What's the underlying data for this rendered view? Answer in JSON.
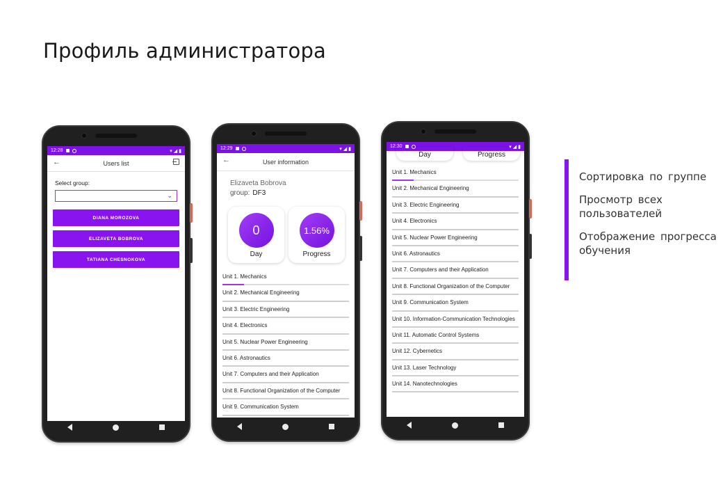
{
  "slide": {
    "title": "Профиль администратора",
    "accent_color": "#8a14f0",
    "bullets": [
      "Сортировка по группе",
      "Просмотр всех пользователей",
      "Отображение прогресса обучения"
    ]
  },
  "phones": [
    {
      "time": "12:28",
      "header": "Users list",
      "select_label": "Select group:",
      "select_value": "",
      "users": [
        "DIANA MOROZOVA",
        "ELIZAVETA BOBROVA",
        "TATIANA CHESNOKOVA"
      ]
    },
    {
      "time": "12:29",
      "header": "User information",
      "user_name": "Elizaveta Bobrova",
      "group_label": "group:",
      "group_value": "DF3",
      "day_value": "0",
      "day_label": "Day",
      "progress_value": "1.56%",
      "progress_label": "Progress",
      "units": [
        "Unit 1. Mechanics",
        "Unit 2. Mechanical Engineering",
        "Unit 3. Electric Engineering",
        "Unit 4. Electronics",
        "Unit 5. Nuclear Power Engineering",
        "Unit 6. Astronautics",
        "Unit 7. Computers and their Application",
        "Unit 8. Functional Organization of the Computer",
        "Unit 9. Communication System"
      ]
    },
    {
      "time": "12:30",
      "day_label": "Day",
      "progress_label": "Progress",
      "units": [
        "Unit 1. Mechanics",
        "Unit 2. Mechanical Engineering",
        "Unit 3. Electric Engineering",
        "Unit 4. Electronics",
        "Unit 5. Nuclear Power Engineering",
        "Unit 6. Astronautics",
        "Unit 7. Computers and their Application",
        "Unit 8. Functional Organization of the Computer",
        "Unit 9. Communication System",
        "Unit 10. Information-Communication Technologies",
        "Unit 11. Automatic Control Systems",
        "Unit 12. Cybernetics",
        "Unit 13. Laser Technology",
        "Unit 14. Nanotechnologies"
      ]
    }
  ]
}
